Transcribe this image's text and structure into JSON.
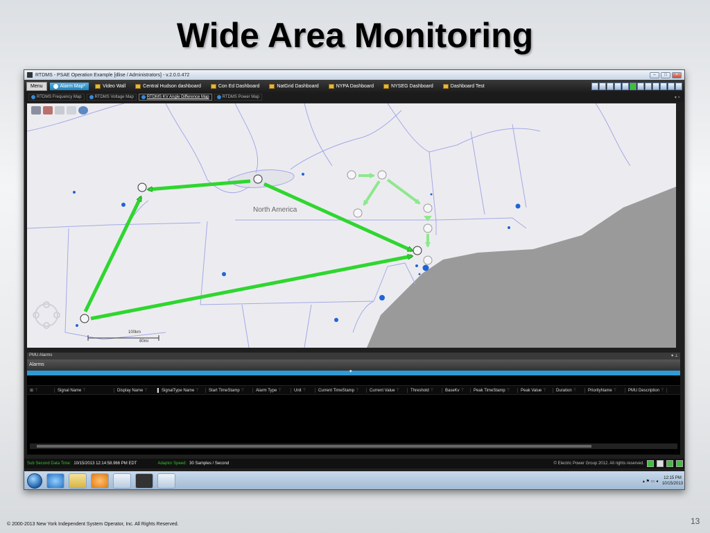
{
  "slide": {
    "title": "Wide Area Monitoring",
    "copyright": "© 2000-2013 New York Independent System Operator, Inc.  All Rights Reserved.",
    "page_number": "13"
  },
  "window": {
    "title": "RTDMS - PSAE Operation Example [dlise / Administrators] - v.2.0.0.472"
  },
  "menubar": {
    "menu_label": "Menu",
    "tabs": [
      {
        "label": "Alarm Map*",
        "active": true
      },
      {
        "label": "Video Wall",
        "active": false
      },
      {
        "label": "Central Hudson dashboard",
        "active": false
      },
      {
        "label": "Con Ed Dashboard",
        "active": false
      },
      {
        "label": "NatGrid Dashboard",
        "active": false
      },
      {
        "label": "NYPA Dashboard",
        "active": false
      },
      {
        "label": "NYSEG Dashboard",
        "active": false
      },
      {
        "label": "Dashboard Test",
        "active": false
      }
    ]
  },
  "subtabs": [
    {
      "label": "RTDMS Frequency Map",
      "active": false
    },
    {
      "label": "RTDMS Voltage Map",
      "active": false
    },
    {
      "label": "RTDMS KV Angle Difference Map",
      "active": true
    },
    {
      "label": "RTDMS Power Map",
      "active": false
    }
  ],
  "map": {
    "region_label": "North America",
    "scale_km": "100km",
    "scale_mi": "80mi",
    "colors": {
      "arrow": "#2fd62f",
      "arrow_light": "#8de88d",
      "point": "#1f64d8",
      "state_border": "#a3a8e8",
      "water": "#9a9a9a",
      "land": "#ececf0"
    }
  },
  "alarms": {
    "panel_title": "PMU Alarms",
    "title": "Alarms",
    "columns": [
      "Signal Name",
      "Display Name",
      "SignalType Name",
      "Start TimeStamp",
      "Alarm Type",
      "Unit",
      "Current TimeStamp",
      "Current Value",
      "Threshold",
      "BaseKv",
      "Peak TimeStamp",
      "Peak Value",
      "Duration",
      "PriorityName",
      "PMU Description"
    ]
  },
  "status": {
    "sub_second_label": "Sub Second Data Time:",
    "sub_second_value": "10/15/2013 12:14:58.966 PM EDT",
    "adaptor_label": "Adaptor Speed:",
    "adaptor_value": "30 Samples / Second",
    "copyright": "© Electric Power Group 2012. All rights reserved."
  },
  "taskbar": {
    "time": "12:15 PM",
    "date": "10/15/2013"
  }
}
